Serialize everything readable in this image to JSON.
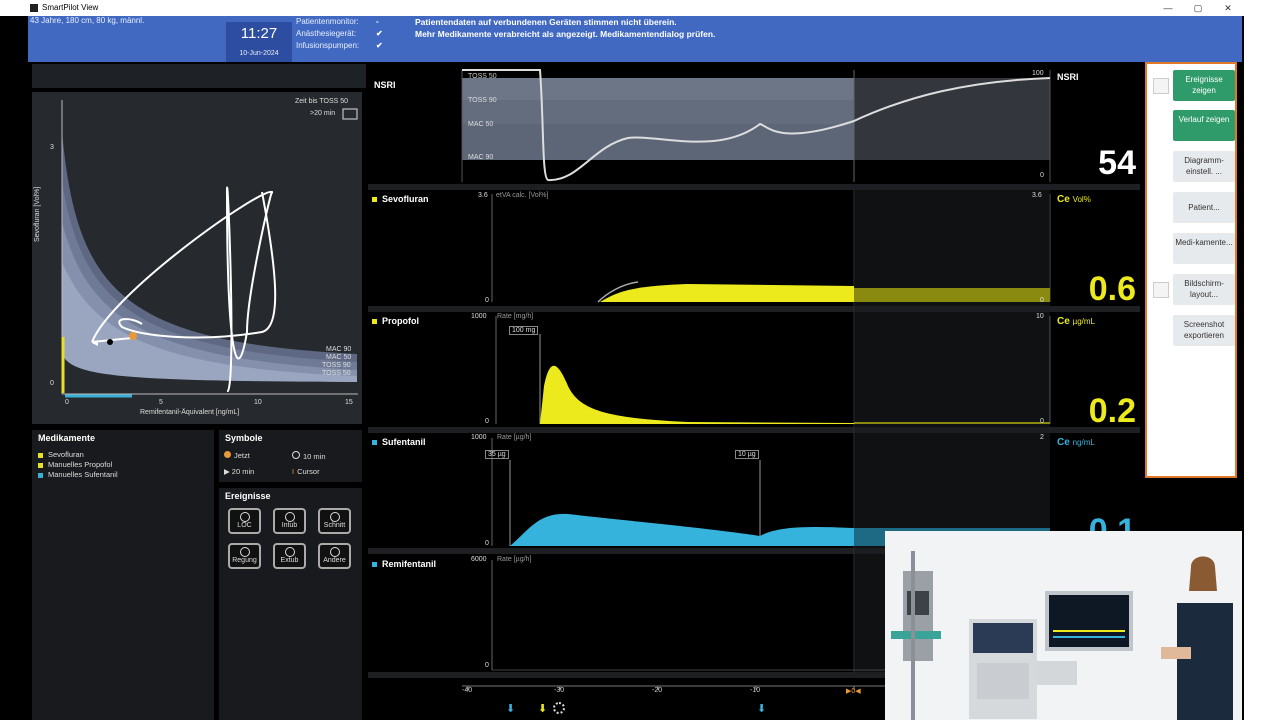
{
  "window": {
    "title": "SmartPilot View"
  },
  "header": {
    "patient": "43 Jahre, 180 cm, 80 kg, männl.",
    "time": "11:27",
    "date": "10-Jun-2024",
    "devices": [
      {
        "label": "Patientenmonitor:",
        "state": "-"
      },
      {
        "label": "Anästhesiegerät:",
        "state": "✔"
      },
      {
        "label": "Infusionspumpen:",
        "state": "✔"
      }
    ],
    "messages": [
      "Patientendaten auf verbundenen Geräten stimmen nicht überein.",
      "Mehr Medikamente verabreicht als angezeigt. Medikamentendialog prüfen."
    ]
  },
  "isobologram": {
    "time_label": "Zeit bis TOSS 50",
    "time_value": ">20 min",
    "ylabel": "Sevofluran [Vol%]",
    "xlabel": "Remifentanil-Äquivalent [ng/mL]",
    "yticks": [
      "3",
      "0"
    ],
    "xticks": [
      "0",
      "5",
      "10",
      "15"
    ],
    "bands": [
      "MAC 90",
      "MAC 50",
      "TOSS 90",
      "TOSS 50"
    ]
  },
  "medikamente": {
    "title": "Medikamente",
    "items": [
      {
        "label": "Sevofluran",
        "color": "#e6e02a"
      },
      {
        "label": "Manuelles Propofol",
        "color": "#e6e02a"
      },
      {
        "label": "Manuelles Sufentanil",
        "color": "#3ab0d6"
      }
    ]
  },
  "symbole": {
    "title": "Symbole",
    "items": [
      {
        "label": "Jetzt",
        "icon": "orange-dot-icon"
      },
      {
        "label": "10 min",
        "icon": "circle-icon"
      },
      {
        "label": "20 min",
        "icon": "triangle-icon"
      },
      {
        "label": "Cursor",
        "icon": "cursor-icon"
      }
    ]
  },
  "ereignisse": {
    "title": "Ereignisse",
    "buttons": [
      "LOC",
      "Intub",
      "Schnitt",
      "Regung",
      "Extub",
      "Andere"
    ]
  },
  "tracks": {
    "nsri": {
      "label": "NSRI",
      "value": "54",
      "top": "100",
      "bottom": "0",
      "bands": [
        "TOSS 50",
        "TOSS 90",
        "MAC 50",
        "MAC 90"
      ]
    },
    "sevo": {
      "label": "Sevofluran",
      "axis": "etVA calc. [Vol%]",
      "ymax": "3.6",
      "ymin": "0",
      "rmax": "3.6",
      "rmin": "0",
      "ce": "Ce",
      "unit": "Vol%",
      "value": "0.6"
    },
    "propofol": {
      "label": "Propofol",
      "axis": "Rate [mg/h]",
      "ymax": "1000",
      "ymin": "0",
      "rmax": "10",
      "rmin": "0",
      "bolus": "100 mg",
      "ce": "Ce",
      "unit": "µg/mL",
      "value": "0.2"
    },
    "sufentanil": {
      "label": "Sufentanil",
      "axis": "Rate [µg/h]",
      "ymax": "1000",
      "ymin": "0",
      "rmax": "2",
      "bolus1": "35 µg",
      "bolus2": "10 µg",
      "ce": "Ce",
      "unit": "ng/mL",
      "value": "0.1"
    },
    "remifentanil": {
      "label": "Remifentanil",
      "axis": "Rate [µg/h]",
      "ymax": "6000",
      "ymin": "0"
    }
  },
  "timeaxis": {
    "ticks": [
      "-40",
      "-30",
      "-20",
      "-10"
    ],
    "now": "0"
  },
  "sidebar": {
    "buttons": [
      {
        "label": "Ereignisse zeigen",
        "active": true
      },
      {
        "label": "Verlauf zeigen",
        "active": true
      },
      {
        "label": "Diagramm-einstell. ...",
        "active": false
      },
      {
        "label": "Patient...",
        "active": false
      },
      {
        "label": "Medi-kamente...",
        "active": false
      },
      {
        "label": "Bildschirm-layout...",
        "active": false
      },
      {
        "label": "Screenshot exportieren",
        "active": false
      }
    ]
  },
  "colors": {
    "yellow": "#ecea1c",
    "blue": "#35b3dc",
    "accent_green": "#2f9a6a",
    "header_blue": "#4169c2",
    "highlight": "#e07a2a"
  }
}
